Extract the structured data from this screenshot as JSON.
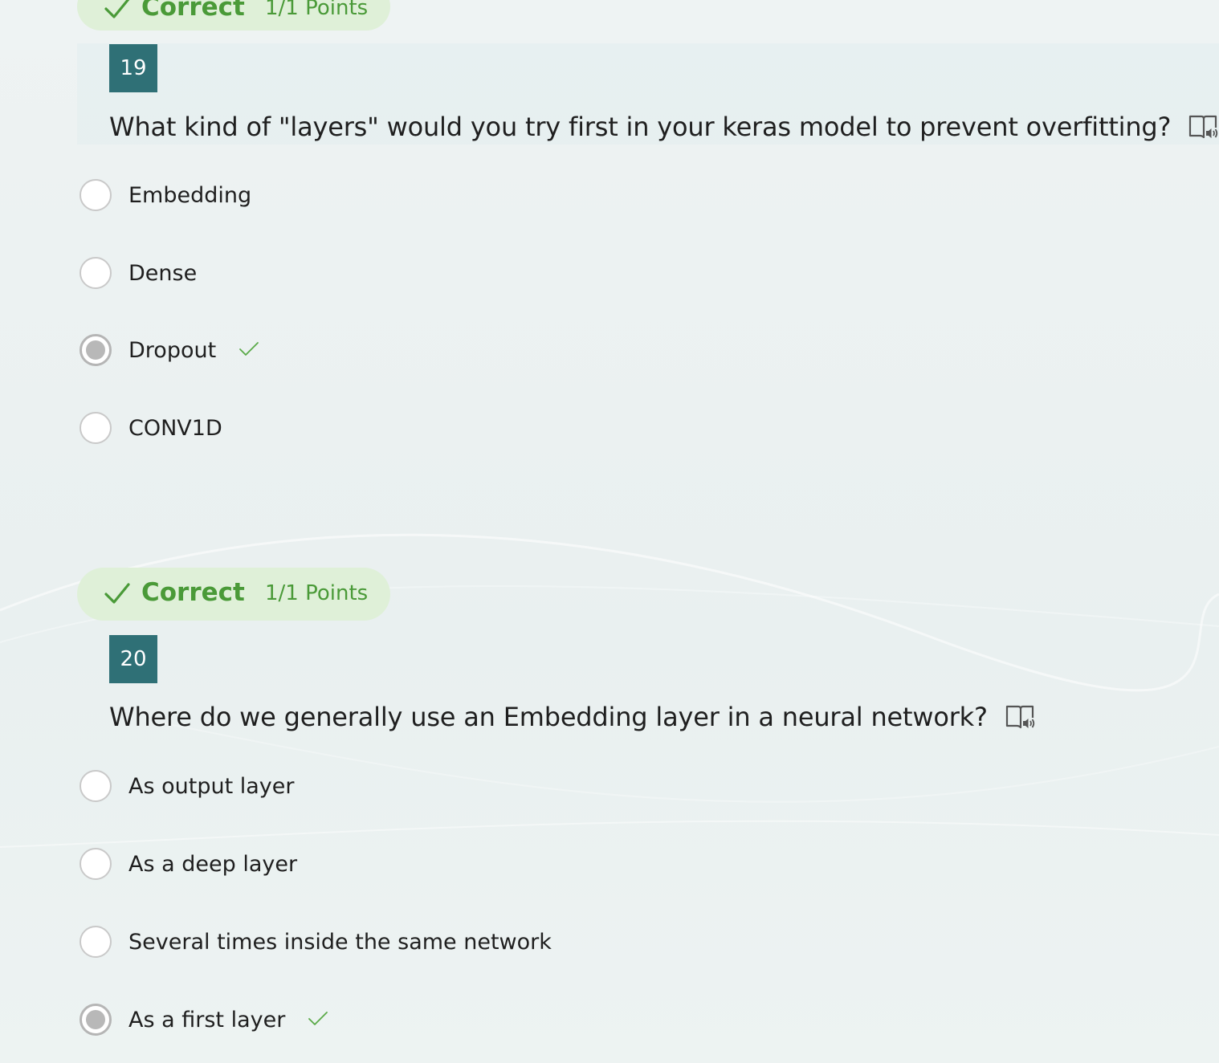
{
  "colors": {
    "correct_green": "#4a9a38",
    "pill_background": "#dff0d8",
    "number_badge": "#2f7076",
    "radio_selected": "#b8b8b8"
  },
  "questions": [
    {
      "result": {
        "label": "Correct",
        "points": "1/1 Points",
        "icon": "check-icon"
      },
      "number": "19",
      "text": "What kind of \"layers\" would you try first in your keras model to prevent overfitting?",
      "reader_icon": "immersive-reader-icon",
      "options": [
        {
          "label": "Embedding",
          "selected": false,
          "correct": false
        },
        {
          "label": "Dense",
          "selected": false,
          "correct": false
        },
        {
          "label": "Dropout",
          "selected": true,
          "correct": true
        },
        {
          "label": "CONV1D",
          "selected": false,
          "correct": false
        }
      ]
    },
    {
      "result": {
        "label": "Correct",
        "points": "1/1 Points",
        "icon": "check-icon"
      },
      "number": "20",
      "text": "Where do we generally use an Embedding layer in a neural network?",
      "reader_icon": "immersive-reader-icon",
      "options": [
        {
          "label": "As output layer",
          "selected": false,
          "correct": false
        },
        {
          "label": "As a deep layer",
          "selected": false,
          "correct": false
        },
        {
          "label": "Several times inside the same network",
          "selected": false,
          "correct": false
        },
        {
          "label": "As a first layer",
          "selected": true,
          "correct": true
        }
      ]
    }
  ]
}
